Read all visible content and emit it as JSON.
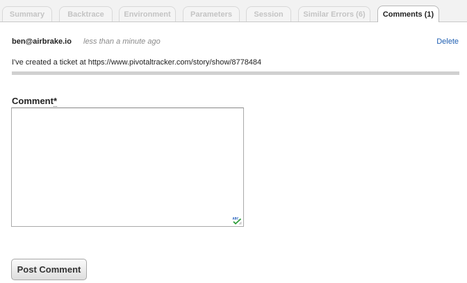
{
  "tabs": [
    {
      "label": "Summary"
    },
    {
      "label": "Backtrace"
    },
    {
      "label": "Environment"
    },
    {
      "label": "Parameters"
    },
    {
      "label": "Session"
    },
    {
      "label": "Similar Errors (6)"
    },
    {
      "label": "Comments (1)",
      "active": true
    }
  ],
  "comment": {
    "author": "ben@airbrake.io",
    "timestamp": "less than a minute ago",
    "delete_label": "Delete",
    "body": "I've created a ticket at https://www.pivotaltracker.com/story/show/8778484"
  },
  "form": {
    "label": "Comment",
    "required_marker": "*",
    "value": "",
    "submit_label": "Post Comment"
  },
  "colors": {
    "link": "#1f5fb2",
    "divider": "#d0d0d0",
    "spellcheck_check": "#2e9d3a"
  }
}
